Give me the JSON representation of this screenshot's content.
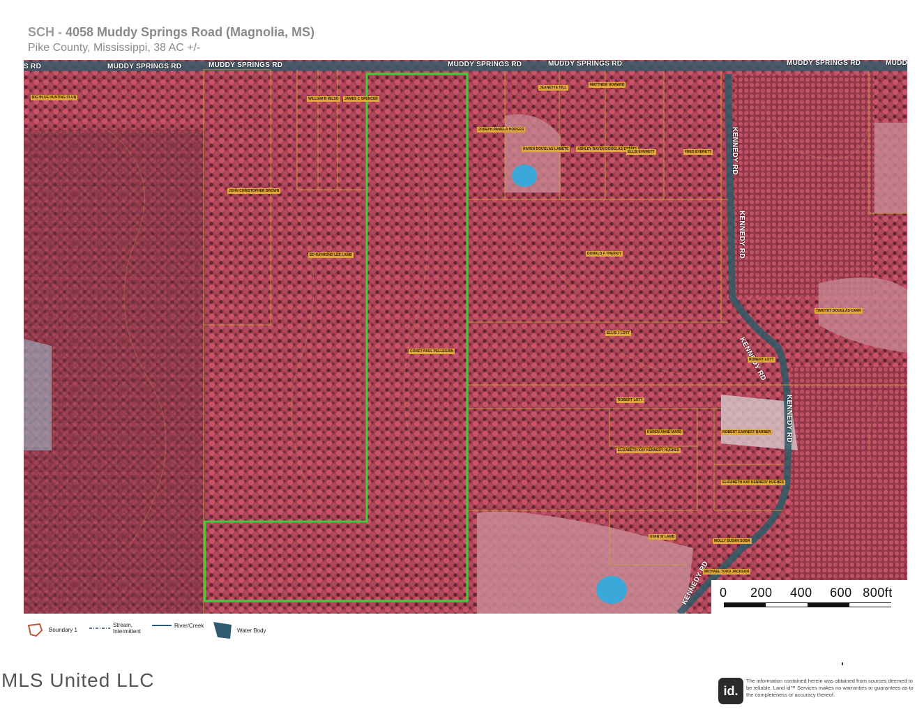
{
  "header": {
    "title_prefix": "SCH -",
    "title_main": "4058 Muddy Springs Road (Magnolia, MS)",
    "subtitle": "Pike County, Mississippi, 38 AC +/-"
  },
  "map": {
    "road_labels": [
      "S RD",
      "MUDDY SPRINGS RD",
      "MUDDY SPRINGS RD",
      "MUDDY SPRINGS RD",
      "MUDDY SPRINGS RD",
      "MUDDY SPRINGS RD",
      "MUDD",
      "KENNEDY RD",
      "KENNEDY RD",
      "KENNEDY RD",
      "KENNEDY RD",
      "KENNEDY RD"
    ],
    "owner_labels": [
      "BIG BLUE HUNTING CLUB",
      "WILLIAM B MILSO",
      "JAMES C SPENCER",
      "JEANETTE HILL",
      "MATTHEW HOWARD",
      "JOSEPH PAMELA HODGES",
      "RAVEN DOUGLAS LAMETE",
      "ASHLEY RAVEN DOUGLAS ESTATE",
      "ELLIS EVERETT",
      "FRED EVERETT",
      "JOHN CHRISTOPHER BROWN",
      "ED RAYMOND LEE LAMB",
      "DONALD F THERIOT",
      "COREY PAUL PELLEGRIN",
      "TIMOTHY DOUGLAS CARR",
      "ELLIS J LOTT",
      "ROBERT LOTT",
      "ROBERT LOTT",
      "KAREN ANNE MARS",
      "ELIZABETH KAY KENNEDY HUGHES",
      "ROBERT EARNEST BARBER",
      "ELIZABETH KAY KENNEDY HUGHES",
      "STAN W LAMB",
      "MOLLY SUSAN SOBA",
      "MICHAEL TODD JACKSON"
    ],
    "colors": {
      "vegetation": "#b8475a",
      "boundary": "#3ccf3c",
      "parcel_lines": "#c8a040",
      "pond": "#3aa8d8",
      "clearing": "#c88a94"
    },
    "scale": {
      "labels": [
        "0",
        "200",
        "400",
        "600",
        "800ft"
      ]
    }
  },
  "legend": {
    "items": [
      {
        "icon": "boundary-icon",
        "label": "Boundary 1"
      },
      {
        "icon": "stream-icon",
        "label": "Stream, Intermittent"
      },
      {
        "icon": "river-icon",
        "label": "River/Creek"
      },
      {
        "icon": "water-body-icon",
        "label": "Water Body"
      }
    ]
  },
  "footer": {
    "watermark": "MLS United LLC",
    "logo_text": "id.",
    "disclaimer": "The information contained herein was obtained from sources deemed to be reliable. Land id™ Services makes no warranties or guarantees as to the completeness or accuracy thereof."
  }
}
